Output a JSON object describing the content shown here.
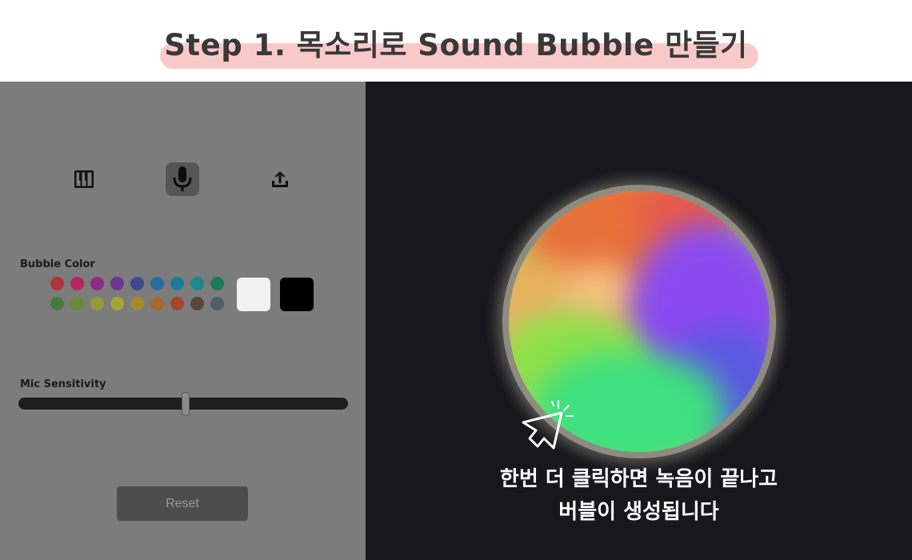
{
  "header": {
    "title": "Step 1. 목소리로 Sound Bubble 만들기",
    "highlight_color": "#f9c9c9"
  },
  "toolbar": {
    "modes": [
      {
        "name": "piano",
        "icon": "piano-keys-icon",
        "active": false
      },
      {
        "name": "microphone",
        "icon": "microphone-icon",
        "active": true
      },
      {
        "name": "upload",
        "icon": "upload-icon",
        "active": false
      }
    ]
  },
  "bubble_color": {
    "label": "Bubble Color",
    "row1": [
      "#b03338",
      "#b52660",
      "#8d2d86",
      "#6a3690",
      "#3d4a8f",
      "#2a6ca0",
      "#1e7a9a",
      "#1b8a8a",
      "#1c7a5e"
    ],
    "row2": [
      "#497a3a",
      "#6c8a3a",
      "#949a3a",
      "#a6a33a",
      "#a8882a",
      "#a76a2a",
      "#a3482a",
      "#5a453e",
      "#4e5e66"
    ],
    "large": [
      "#f2f2f2",
      "#000000"
    ]
  },
  "mic": {
    "label": "Mic Sensitivity",
    "value": 0.5
  },
  "reset": {
    "label": "Reset"
  },
  "caption": {
    "line1": "한번 더 클릭하면 녹음이 끝나고",
    "line2": "버블이 생성됩니다"
  }
}
